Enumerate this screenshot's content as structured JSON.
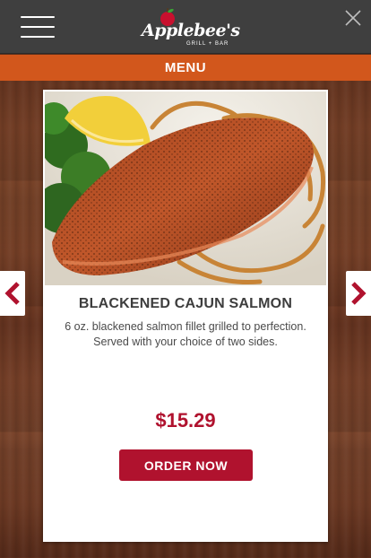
{
  "header": {
    "logo_text": "Applebee's",
    "logo_subtext": "GRILL + BAR",
    "menu_icon": "hamburger-menu-icon",
    "close_icon": "close-icon"
  },
  "menubar": {
    "label": "MENU"
  },
  "navigation": {
    "prev_icon": "chevron-left-icon",
    "next_icon": "chevron-right-icon"
  },
  "item": {
    "title": "BLACKENED CAJUN SALMON",
    "description": "6 oz. blackened salmon fillet grilled to perfection. Served with your choice of two sides.",
    "price": "$15.29",
    "order_label": "ORDER NOW"
  },
  "colors": {
    "header_bg": "#3f3f3f",
    "menubar_bg": "#d2571c",
    "brand_red": "#b0122e",
    "wood": "#6b3822"
  }
}
